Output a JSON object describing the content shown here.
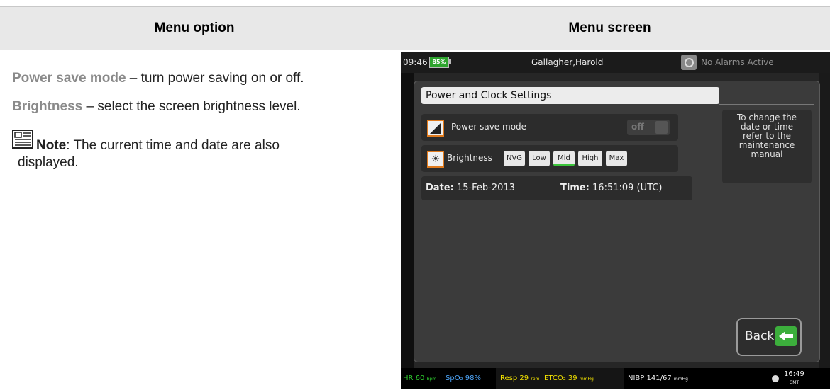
{
  "table": {
    "header_option": "Menu option",
    "header_screen": "Menu screen"
  },
  "description": {
    "power_term": "Power save mode",
    "power_text": " – turn power saving on or off.",
    "brightness_term": "Brightness",
    "brightness_text": " – select the screen brightness level.",
    "note_label": "Note",
    "note_text": ": The current time and date are also",
    "note_text_2": "displayed."
  },
  "device": {
    "clock": "09:46",
    "battery": "85%",
    "patient": "Gallagher,Harold",
    "alarm_status": "No Alarms Active",
    "dialog_title": "Power and Clock Settings",
    "power_save_label": "Power save mode",
    "toggle_state": "off",
    "brightness_label": "Brightness",
    "brightness_options": [
      "NVG",
      "Low",
      "Mid",
      "High",
      "Max"
    ],
    "brightness_selected": "Mid",
    "date_label": "Date:",
    "date_value": "15-Feb-2013",
    "time_label": "Time:",
    "time_value": "16:51:09 (UTC)",
    "help_text_1": "To change the",
    "help_text_2": "date or time",
    "help_text_3": "refer to the",
    "help_text_4": "maintenance",
    "help_text_5": "manual",
    "back_label": "Back"
  },
  "status_bar": {
    "hr_label": "HR",
    "hr_value": "60",
    "hr_unit": "bpm",
    "spo2_label": "SpO₂",
    "spo2_value": "98%",
    "resp_label": "Resp",
    "resp_value": "29",
    "resp_unit": "rpm",
    "etco2_label": "ETCO₂",
    "etco2_value": "39",
    "etco2_unit": "mmHg",
    "nibp_label": "NIBP",
    "nibp_value": "141/67",
    "nibp_unit": "mmHg",
    "time": "16:49",
    "timezone": "GMT"
  },
  "colors": {
    "accent_orange": "#e07a1c",
    "status_green": "#2fd02f",
    "spo2_blue": "#4fa9ff",
    "resp_yellow": "#f0e000",
    "back_green": "#3cae3c"
  }
}
